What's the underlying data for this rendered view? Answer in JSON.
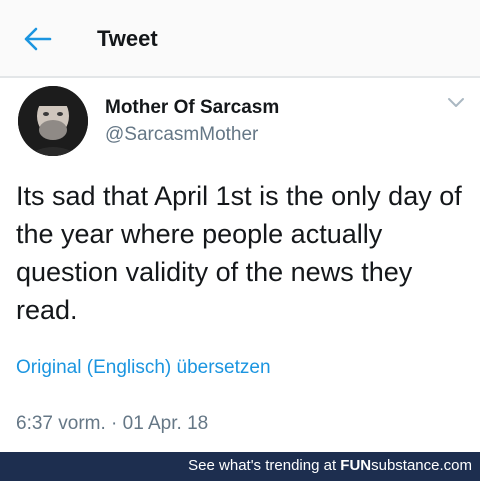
{
  "header": {
    "title": "Tweet",
    "back_icon": "arrow-left-icon",
    "accent": "#1b95e0"
  },
  "user": {
    "name": "Mother Of Sarcasm",
    "handle": "@SarcasmMother"
  },
  "tweet": {
    "text": "Its sad that April 1st is the only day of the year where people actually question validity of the news they read.",
    "translate_link": "Original (Englisch) übersetzen",
    "timestamp": "6:37 vorm. · 01 Apr. 18"
  },
  "footer": {
    "prefix": "See what's trending at ",
    "brand_fun": "FUN",
    "brand_rest": "substance.com"
  }
}
